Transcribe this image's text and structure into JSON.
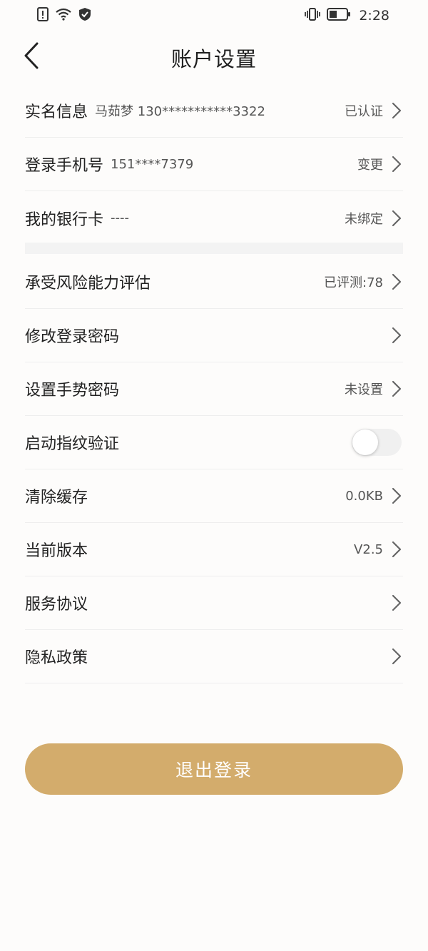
{
  "status_bar": {
    "time": "2:28",
    "icons": [
      "alert-icon",
      "wifi-icon",
      "shield-icon",
      "vibrate-icon",
      "battery-icon"
    ]
  },
  "header": {
    "title": "账户设置",
    "back_icon": "chevron-left-icon"
  },
  "account_section": [
    {
      "label": "实名信息",
      "detail": "马茹梦 130***********3322",
      "value": "已认证"
    },
    {
      "label": "登录手机号",
      "detail": "151****7379",
      "value": "变更"
    },
    {
      "label": "我的银行卡",
      "detail": "----",
      "value": "未绑定"
    }
  ],
  "settings_section": {
    "risk": {
      "label": "承受风险能力评估",
      "value": "已评测:78"
    },
    "login_password": {
      "label": "修改登录密码",
      "value": ""
    },
    "gesture_password": {
      "label": "设置手势密码",
      "value": "未设置"
    },
    "fingerprint": {
      "label": "启动指纹验证",
      "enabled": false
    },
    "cache": {
      "label": "清除缓存",
      "value": "0.0KB"
    },
    "version": {
      "label": "当前版本",
      "value": "V2.5"
    },
    "service_agreement": {
      "label": "服务协议",
      "value": ""
    },
    "privacy_policy": {
      "label": "隐私政策",
      "value": ""
    }
  },
  "logout_button": {
    "label": "退出登录"
  },
  "colors": {
    "accent": "#d3ac6c",
    "background": "#fdfcfb",
    "divider": "#eeeeee",
    "text_primary": "#222222",
    "text_secondary": "#555555"
  }
}
